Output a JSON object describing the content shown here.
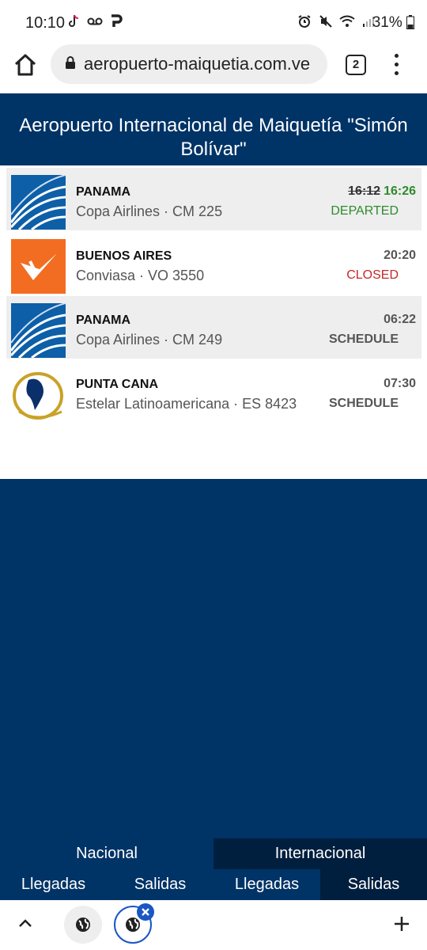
{
  "status_bar": {
    "time": "10:10",
    "battery": "31%",
    "left_icons": [
      "tiktok-icon",
      "voicemail-icon",
      "p-app-icon"
    ],
    "right_icons": [
      "alarm-icon",
      "mute-icon",
      "wifi-icon",
      "signal-icon",
      "battery-icon"
    ]
  },
  "browser": {
    "url": "aeropuerto-maiquetia.com.ve",
    "tab_count": "2"
  },
  "page": {
    "title": "Aeropuerto Internacional de Maiquetía \"Simón\nBolívar\""
  },
  "flights": [
    {
      "destination": "PANAMA",
      "airline": "Copa Airlines · CM 225",
      "scheduled_time": "16:12",
      "actual_time": "16:26",
      "status": "DEPARTED",
      "logo": "copa-airlines-logo"
    },
    {
      "destination": "BUENOS AIRES",
      "airline": "Conviasa · VO 3550",
      "time": "20:20",
      "status": "CLOSED",
      "logo": "conviasa-logo"
    },
    {
      "destination": "PANAMA",
      "airline": "Copa Airlines · CM 249",
      "time": "06:22",
      "status": "SCHEDULE",
      "logo": "copa-airlines-logo"
    },
    {
      "destination": "PUNTA CANA",
      "airline": "Estelar Latinoamericana · ES 8423",
      "time": "07:30",
      "status": "SCHEDULE",
      "logo": "estelar-logo"
    }
  ],
  "tabs": {
    "nacional": "Nacional",
    "internacional": "Internacional",
    "nacional_llegadas": "Llegadas",
    "nacional_salidas": "Salidas",
    "internacional_llegadas": "Llegadas",
    "internacional_salidas": "Salidas",
    "active_tab": "Internacional",
    "active_sub": "Salidas"
  },
  "colors": {
    "header_bg": "#003366",
    "active_tab_bg": "#001f3f",
    "departed": "#2e8b2e",
    "closed": "#c62828",
    "accent_blue": "#1a56c4"
  }
}
